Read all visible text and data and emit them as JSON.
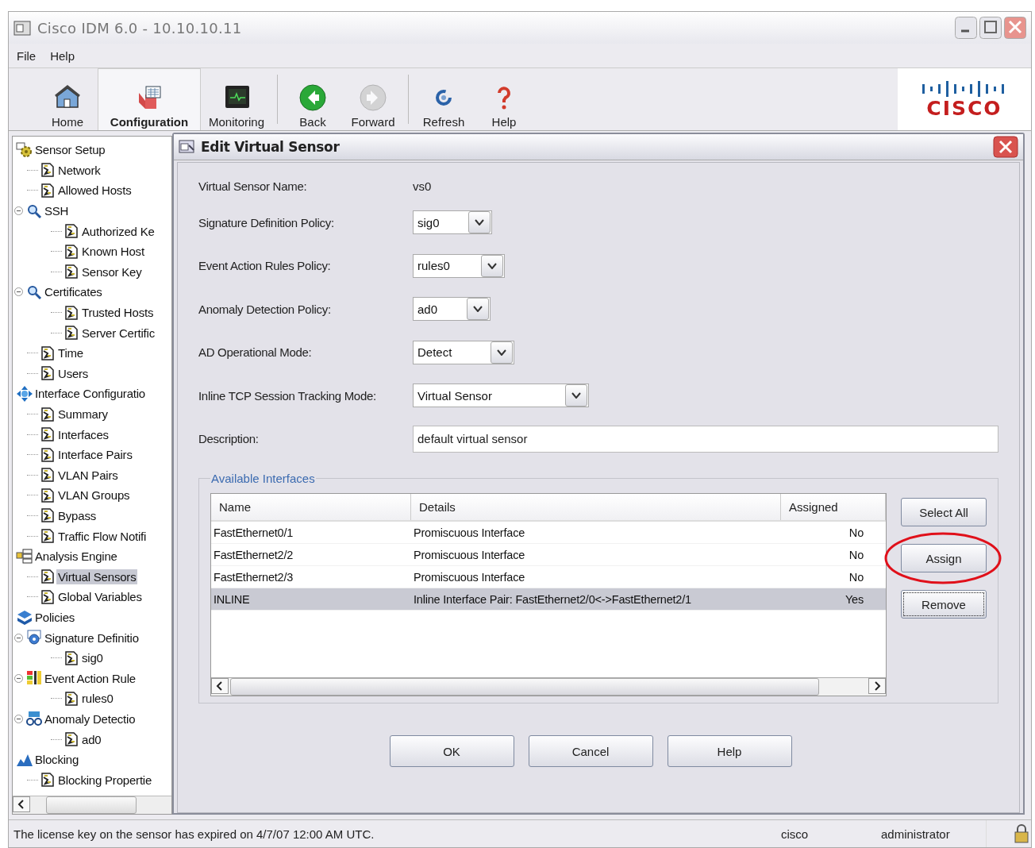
{
  "window": {
    "title": "Cisco IDM 6.0 - 10.10.10.11"
  },
  "menu": [
    "File",
    "Help"
  ],
  "toolbar": [
    {
      "label": "Home",
      "selected": false,
      "disabled": false
    },
    {
      "label": "Configuration",
      "selected": true,
      "disabled": false
    },
    {
      "label": "Monitoring",
      "selected": false,
      "disabled": false
    },
    {
      "label": "Back",
      "selected": false,
      "disabled": false
    },
    {
      "label": "Forward",
      "selected": false,
      "disabled": true
    },
    {
      "label": "Refresh",
      "selected": false,
      "disabled": false
    },
    {
      "label": "Help",
      "selected": false,
      "disabled": false
    }
  ],
  "logo": {
    "text": "CISCO"
  },
  "tree": [
    {
      "label": "Sensor Setup",
      "selected": false,
      "children": [
        {
          "label": "Network",
          "selected": false
        },
        {
          "label": "Allowed Hosts",
          "selected": false
        },
        {
          "label": "SSH",
          "selected": false,
          "expanded": true,
          "children": [
            {
              "label": "Authorized Ke",
              "selected": false
            },
            {
              "label": "Known Host",
              "selected": false
            },
            {
              "label": "Sensor Key",
              "selected": false
            }
          ]
        },
        {
          "label": "Certificates",
          "selected": false,
          "expanded": true,
          "children": [
            {
              "label": "Trusted Hosts",
              "selected": false
            },
            {
              "label": "Server Certific",
              "selected": false
            }
          ]
        },
        {
          "label": "Time",
          "selected": false
        },
        {
          "label": "Users",
          "selected": false
        }
      ]
    },
    {
      "label": "Interface Configuratio",
      "selected": false,
      "children": [
        {
          "label": "Summary",
          "selected": false
        },
        {
          "label": "Interfaces",
          "selected": false
        },
        {
          "label": "Interface Pairs",
          "selected": false
        },
        {
          "label": "VLAN Pairs",
          "selected": false
        },
        {
          "label": "VLAN Groups",
          "selected": false
        },
        {
          "label": "Bypass",
          "selected": false
        },
        {
          "label": "Traffic Flow Notifi",
          "selected": false
        }
      ]
    },
    {
      "label": "Analysis Engine",
      "selected": false,
      "children": [
        {
          "label": "Virtual Sensors",
          "selected": true
        },
        {
          "label": "Global Variables",
          "selected": false
        }
      ]
    },
    {
      "label": "Policies",
      "selected": false,
      "children": [
        {
          "label": "Signature Definitio",
          "selected": false,
          "expanded": true,
          "children": [
            {
              "label": "sig0",
              "selected": false
            }
          ]
        },
        {
          "label": "Event Action Rule",
          "selected": false,
          "expanded": true,
          "children": [
            {
              "label": "rules0",
              "selected": false
            }
          ]
        },
        {
          "label": "Anomaly Detectio",
          "selected": false,
          "expanded": true,
          "children": [
            {
              "label": "ad0",
              "selected": false
            }
          ]
        }
      ]
    },
    {
      "label": "Blocking",
      "selected": false,
      "children": [
        {
          "label": "Blocking Propertie",
          "selected": false
        }
      ]
    }
  ],
  "dialog": {
    "title": "Edit Virtual Sensor",
    "fields": [
      {
        "kind": "text",
        "label": "Virtual Sensor Name:",
        "value": "vs0"
      },
      {
        "kind": "combo",
        "label": "Signature Definition Policy:",
        "value": "sig0"
      },
      {
        "kind": "combo",
        "label": "Event Action Rules Policy:",
        "value": "rules0"
      },
      {
        "kind": "combo",
        "label": "Anomaly Detection Policy:",
        "value": "ad0"
      },
      {
        "kind": "combo",
        "label": "AD Operational Mode:",
        "value": "Detect"
      },
      {
        "kind": "combo",
        "label": "Inline TCP Session Tracking Mode:",
        "value": "Virtual Sensor"
      },
      {
        "kind": "input",
        "label": "Description:",
        "value": "default virtual sensor"
      }
    ],
    "group": {
      "title": "Available Interfaces",
      "table": {
        "columns": [
          "Name",
          "Details",
          "Assigned"
        ],
        "rows": [
          {
            "cells": [
              "FastEthernet0/1",
              "Promiscuous Interface",
              "No"
            ],
            "selected": false
          },
          {
            "cells": [
              "FastEthernet2/2",
              "Promiscuous Interface",
              "No"
            ],
            "selected": false
          },
          {
            "cells": [
              "FastEthernet2/3",
              "Promiscuous Interface",
              "No"
            ],
            "selected": false
          },
          {
            "cells": [
              "INLINE",
              "Inline Interface Pair: FastEthernet2/0<->FastEthernet2/1",
              "Yes"
            ],
            "selected": true
          }
        ]
      },
      "buttons": [
        {
          "label": "Select All",
          "focused": false,
          "highlighted": false
        },
        {
          "label": "Assign",
          "focused": false,
          "highlighted": true
        },
        {
          "label": "Remove",
          "focused": true,
          "highlighted": false
        }
      ]
    },
    "buttons": [
      "OK",
      "Cancel",
      "Help"
    ]
  },
  "status_bar": {
    "message": "The license key on the sensor has expired on 4/7/07 12:00 AM UTC.",
    "host": "cisco",
    "user": "administrator"
  }
}
